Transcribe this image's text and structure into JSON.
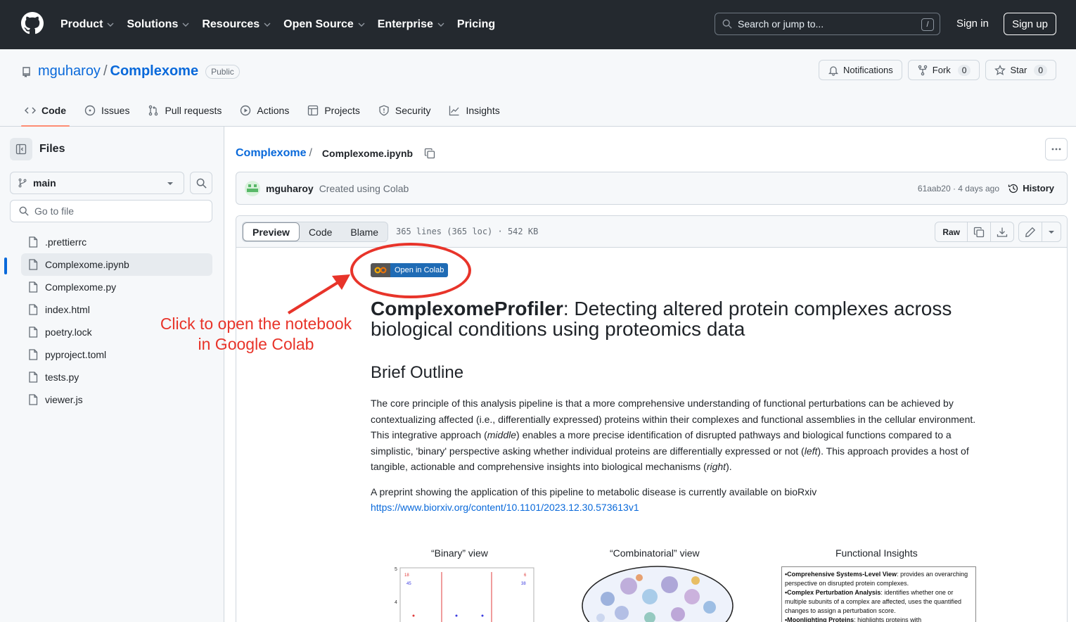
{
  "header": {
    "nav": [
      "Product",
      "Solutions",
      "Resources",
      "Open Source",
      "Enterprise",
      "Pricing"
    ],
    "search_placeholder": "Search or jump to...",
    "search_shortcut": "/",
    "signin": "Sign in",
    "signup": "Sign up"
  },
  "repo": {
    "owner": "mguharoy",
    "name": "Complexome",
    "visibility": "Public",
    "notifications": "Notifications",
    "fork_label": "Fork",
    "fork_count": "0",
    "star_label": "Star",
    "star_count": "0",
    "tabs": [
      "Code",
      "Issues",
      "Pull requests",
      "Actions",
      "Projects",
      "Security",
      "Insights"
    ]
  },
  "sidebar": {
    "title": "Files",
    "branch": "main",
    "goto_placeholder": "Go to file",
    "files": [
      ".prettierrc",
      "Complexome.ipynb",
      "Complexome.py",
      "index.html",
      "poetry.lock",
      "pyproject.toml",
      "tests.py",
      "viewer.js"
    ],
    "active_file": "Complexome.ipynb"
  },
  "breadcrumb": {
    "repo": "Complexome",
    "sep": "/",
    "file": "Complexome.ipynb"
  },
  "commit": {
    "author": "mguharoy",
    "message": "Created using Colab",
    "meta": "61aab20 · 4 days ago",
    "history": "History"
  },
  "filebar": {
    "modes": [
      "Preview",
      "Code",
      "Blame"
    ],
    "info": "365 lines (365 loc) · 542 KB",
    "raw": "Raw"
  },
  "notebook": {
    "colab_badge": "Open in Colab",
    "title_bold": "ComplexomeProfiler",
    "title_rest": ": Detecting altered protein complexes across biological conditions using proteomics data",
    "outline_heading": "Brief Outline",
    "para1_a": "The core principle of this analysis pipeline is that a more comprehensive understanding of functional perturbations can be achieved by contextualizing affected (i.e., differentially expressed) proteins within their complexes and functional assemblies in the cellular environment. This integrative approach (",
    "para1_middle": "middle",
    "para1_b": ") enables a more precise identification of disrupted pathways and biological functions compared to a simplistic, 'binary' perspective asking whether individual proteins are differentially expressed or not (",
    "para1_left": "left",
    "para1_c": "). This approach provides a host of tangible, actionable and comprehensive insights into biological mechanisms (",
    "para1_right": "right",
    "para1_d": ").",
    "para2": "A preprint showing the application of this pipeline to metabolic disease is currently available on bioRxiv",
    "link": "https://www.biorxiv.org/content/10.1101/2023.12.30.573613v1",
    "fig_labels": [
      "“Binary” view",
      "“Combinatorial” view",
      "Functional Insights"
    ],
    "fig_numbers": [
      "5",
      "4",
      "18",
      "45",
      "6",
      "38"
    ],
    "insights": [
      {
        "bold": "•Comprehensive Systems-Level View",
        "text": ": provides an overarching perspective on disrupted protein complexes."
      },
      {
        "bold": "•Complex Perturbation Analysis",
        "text": ": identifies whether one or multiple subunits of a complex are affected, uses the quantified changes to assign a perturbation score."
      },
      {
        "bold": "•Moonlighting Proteins",
        "text": ": highlights proteins with"
      }
    ]
  },
  "annotation": {
    "line1": "Click to open the notebook",
    "line2": "in Google Colab",
    "color": "#e8342a"
  },
  "colors": {
    "header_bg": "#24292f",
    "link": "#0969da",
    "tab_underline": "#fd8c73"
  }
}
